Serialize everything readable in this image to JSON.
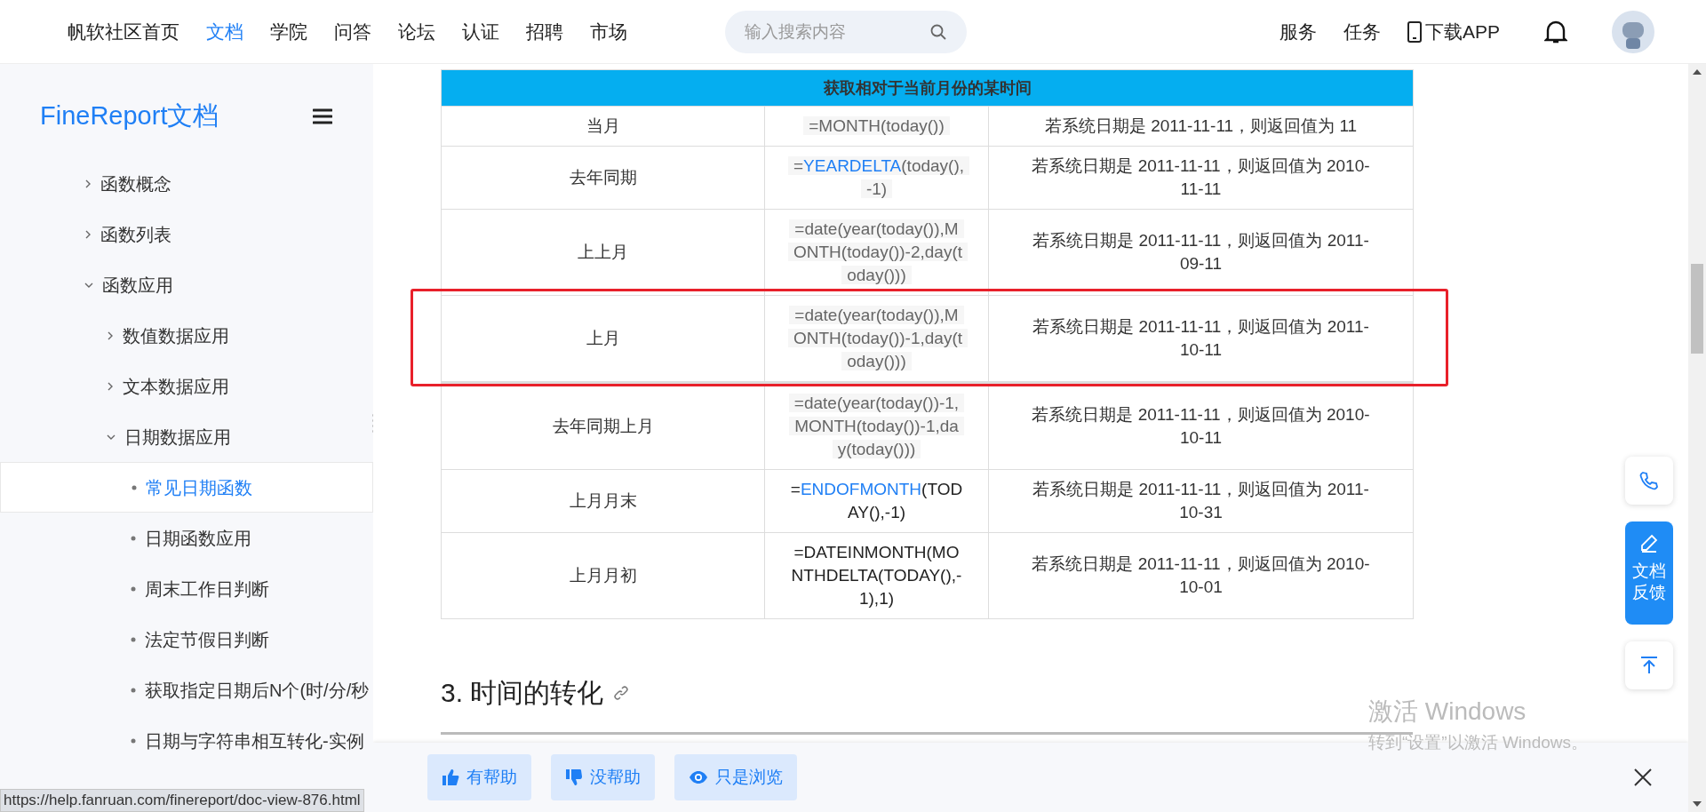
{
  "nav": {
    "items": [
      {
        "label": "帆软社区首页",
        "selected": false
      },
      {
        "label": "文档",
        "selected": true
      },
      {
        "label": "学院",
        "selected": false
      },
      {
        "label": "问答",
        "selected": false
      },
      {
        "label": "论坛",
        "selected": false
      },
      {
        "label": "认证",
        "selected": false
      },
      {
        "label": "招聘",
        "selected": false
      },
      {
        "label": "市场",
        "selected": false
      }
    ],
    "search": {
      "placeholder": "输入搜索内容"
    },
    "right_links": [
      "服务",
      "任务"
    ],
    "download": "下载APP"
  },
  "sidebar": {
    "title": "FineReport文档",
    "items": [
      {
        "label": "函数概念",
        "expanded": false,
        "selected": false
      },
      {
        "label": "函数列表",
        "expanded": false,
        "selected": false
      },
      {
        "label": "函数应用",
        "expanded": true,
        "selected": false,
        "children": [
          {
            "label": "数值数据应用",
            "expanded": false,
            "selected": false
          },
          {
            "label": "文本数据应用",
            "expanded": false,
            "selected": false
          },
          {
            "label": "日期数据应用",
            "expanded": true,
            "selected": false,
            "children": [
              {
                "label": "常见日期函数",
                "selected": true
              },
              {
                "label": "日期函数应用",
                "selected": false
              },
              {
                "label": "周末工作日判断",
                "selected": false
              },
              {
                "label": "法定节假日判断",
                "selected": false
              },
              {
                "label": "获取指定日期后N个(时/分/秒",
                "selected": false
              },
              {
                "label": "日期与字符串相互转化-实例",
                "selected": false
              }
            ]
          }
        ]
      }
    ]
  },
  "table": {
    "header": "获取相对于当前月份的某时间",
    "rows": [
      {
        "name": "当月",
        "shaded": true,
        "formula": [
          {
            "text": "=MONTH(today())",
            "link": false
          }
        ],
        "result": "若系统日期是 2011-11-11，则返回值为 11",
        "highlighted": false
      },
      {
        "name": "去年同期",
        "shaded": true,
        "formula": [
          {
            "text": "=",
            "link": false
          },
          {
            "text": "YEARDELTA",
            "link": true
          },
          {
            "text": "(today(),-1)",
            "link": false
          }
        ],
        "result": "若系统日期是 2011-11-11，则返回值为 2010-11-11",
        "highlighted": false
      },
      {
        "name": "上上月",
        "shaded": true,
        "formula": [
          {
            "text": "=date(year(today()),MONTH(today())-2,day(today()))",
            "link": false
          }
        ],
        "result": "若系统日期是 2011-11-11，则返回值为 2011-09-11",
        "highlighted": false
      },
      {
        "name": "上月",
        "shaded": true,
        "formula": [
          {
            "text": "=date(year(today()),MONTH(today())-1,day(today()))",
            "link": false
          }
        ],
        "result": "若系统日期是 2011-11-11，则返回值为 2011-10-11",
        "highlighted": true
      },
      {
        "name": "去年同期上月",
        "shaded": true,
        "formula": [
          {
            "text": "=date(year(today())-1,MONTH(today())-1,day(today()))",
            "link": false
          }
        ],
        "result": "若系统日期是 2011-11-11，则返回值为 2010-10-11",
        "highlighted": false
      },
      {
        "name": "上月月末",
        "shaded": false,
        "formula": [
          {
            "text": "=",
            "link": false
          },
          {
            "text": "ENDOFMONTH",
            "link": true
          },
          {
            "text": "(TODAY(),-1)",
            "link": false
          }
        ],
        "result": "若系统日期是 2011-11-11，则返回值为 2011-10-31",
        "highlighted": false
      },
      {
        "name": "上月月初",
        "shaded": false,
        "formula": [
          {
            "text": "=DATEINMONTH(MONTHDELTA(TODAY(),-1),1)",
            "link": false
          }
        ],
        "result": "若系统日期是 2011-11-11，则返回值为 2010-10-01",
        "highlighted": false
      }
    ]
  },
  "section_heading": "3. 时间的转化",
  "feedback": {
    "buttons": [
      {
        "kind": "up",
        "label": "有帮助"
      },
      {
        "kind": "down",
        "label": "没帮助"
      },
      {
        "kind": "view",
        "label": "只是浏览"
      }
    ]
  },
  "float_buttons": {
    "feedback_label": "文档反馈"
  },
  "status_url": "https://help.fanruan.com/finereport/doc-view-876.html",
  "windows_notice": {
    "title": "激活 Windows",
    "subtitle": "转到“设置”以激活 Windows。"
  }
}
